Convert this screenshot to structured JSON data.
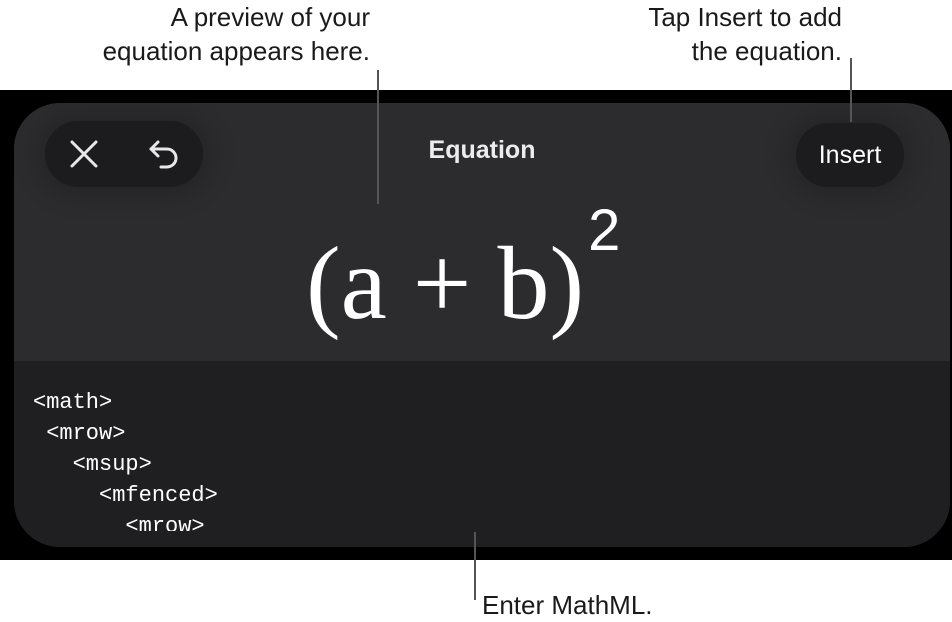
{
  "callouts": {
    "preview": [
      "A preview of your",
      "equation appears here."
    ],
    "insert": [
      "Tap Insert to add",
      "the equation."
    ],
    "mathml": "Enter MathML."
  },
  "toolbar": {
    "close_icon": "close-icon",
    "undo_icon": "undo-icon",
    "title": "Equation",
    "insert_label": "Insert"
  },
  "preview": {
    "equation": "(a + b)",
    "exponent": "2"
  },
  "editor": {
    "lines": [
      "<math>",
      " <mrow>",
      "   <msup>",
      "     <mfenced>",
      "       <mrow>"
    ]
  },
  "colors": {
    "frame": "#000000",
    "panel": "#2c2c2e",
    "editor_bg": "#1f1f21",
    "button_bg": "#1c1c1e",
    "text": "#ffffff"
  }
}
